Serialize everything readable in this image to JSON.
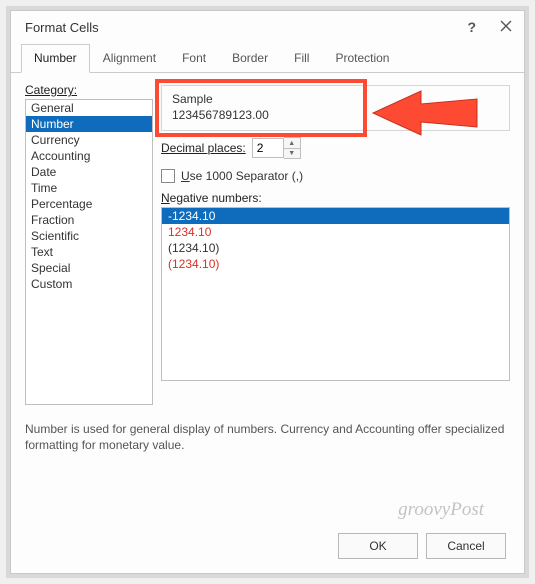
{
  "window": {
    "title": "Format Cells",
    "help_label": "?",
    "close_label": "×"
  },
  "tabs": [
    {
      "label": "Number",
      "active": true
    },
    {
      "label": "Alignment",
      "active": false
    },
    {
      "label": "Font",
      "active": false
    },
    {
      "label": "Border",
      "active": false
    },
    {
      "label": "Fill",
      "active": false
    },
    {
      "label": "Protection",
      "active": false
    }
  ],
  "category": {
    "label": "Category:",
    "items": [
      "General",
      "Number",
      "Currency",
      "Accounting",
      "Date",
      "Time",
      "Percentage",
      "Fraction",
      "Scientific",
      "Text",
      "Special",
      "Custom"
    ],
    "selected_index": 1
  },
  "sample": {
    "label": "Sample",
    "value": "123456789123.00"
  },
  "decimal": {
    "label": "Decimal places:",
    "value": "2"
  },
  "separator": {
    "label": "Use 1000 Separator (,)",
    "checked": false
  },
  "negative": {
    "label": "Negative numbers:",
    "items": [
      {
        "text": "-1234.10",
        "color": "black",
        "selected": true
      },
      {
        "text": "1234.10",
        "color": "red",
        "selected": false
      },
      {
        "text": "(1234.10)",
        "color": "black",
        "selected": false
      },
      {
        "text": "(1234.10)",
        "color": "red",
        "selected": false
      }
    ]
  },
  "description": "Number is used for general display of numbers.  Currency and Accounting offer specialized formatting for monetary value.",
  "buttons": {
    "ok": "OK",
    "cancel": "Cancel"
  },
  "watermark": "groovyPost"
}
